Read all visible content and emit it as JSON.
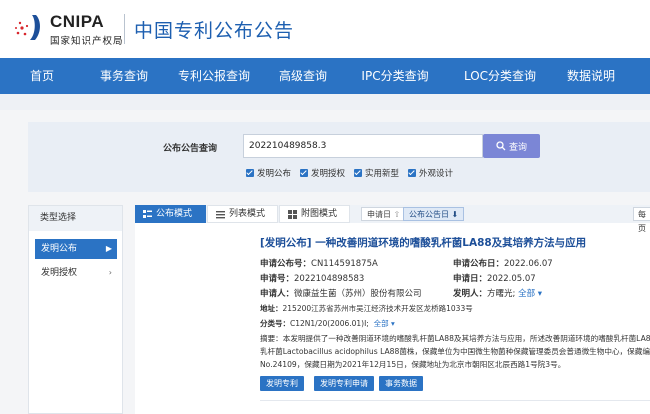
{
  "header": {
    "logo_en": "CNIPA",
    "logo_cn": "国家知识产权局",
    "site_title": "中国专利公布公告"
  },
  "nav": {
    "items": [
      "首页",
      "事务查询",
      "专利公报查询",
      "高级查询",
      "IPC分类查询",
      "LOC分类查询",
      "数据说明"
    ]
  },
  "search": {
    "label": "公布公告查询",
    "value": "202210489858.3",
    "button_label": "查询",
    "checkboxes": [
      "发明公布",
      "发明授权",
      "实用新型",
      "外观设计"
    ]
  },
  "sidebar": {
    "header": "类型选择",
    "items": [
      "发明公布",
      "发明授权"
    ]
  },
  "tabs": {
    "items": [
      "公布模式",
      "列表模式",
      "附图模式"
    ],
    "sort_apply_date": "申请日",
    "sort_pub_date": "公布公告日",
    "per_page": "每页"
  },
  "record": {
    "title": "[发明公布] 一种改善阴道环境的嗜酸乳杆菌LA88及其培养方法与应用",
    "pub_no_label": "申请公布号：",
    "pub_no": "CN114591875A",
    "pub_date_label": "申请公布日：",
    "pub_date": "2022.06.07",
    "app_no_label": "申请号：",
    "app_no": "2022104898583",
    "app_date_label": "申请日：",
    "app_date": "2022.05.07",
    "applicant_label": "申请人：",
    "applicant": "微康益生菌（苏州）股份有限公司",
    "inventor_label": "发明人：",
    "inventor": "方曙光;",
    "inventor_more": "全部",
    "address_label": "地址：",
    "address": "215200江苏省苏州市吴江经济技术开发区龙桥路1033号",
    "class_label": "分类号：",
    "class_no": "C12N1/20(2006.01)I;",
    "class_more": "全部",
    "abstract_lines": [
      "摘要：本发明提供了一种改善阴道环境的嗜酸乳杆菌LA88及其培养方法与应用，所述改善阴道环境的嗜酸乳杆菌LA88",
      "乳杆菌Lactobacillus acidophilus LA88菌株，保藏单位为中国微生物菌种保藏管理委员会普通微生物中心，保藏编号为",
      "No.24109，保藏日期为2021年12月15日，保藏地址为北京市朝阳区北辰西路1号院3号。"
    ],
    "actions": [
      "发明专利",
      "发明专利申请",
      "事务数据"
    ]
  }
}
